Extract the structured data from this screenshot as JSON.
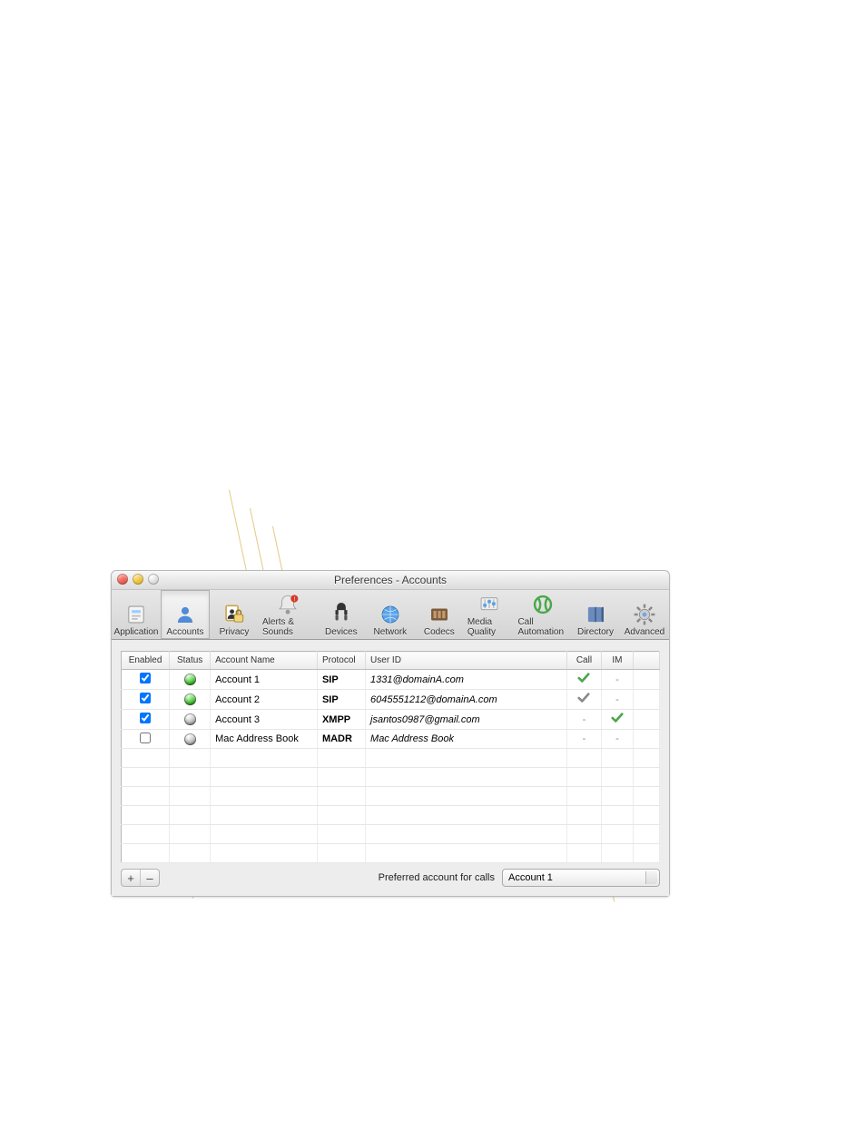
{
  "window_title": "Preferences - Accounts",
  "toolbar": [
    {
      "id": "application",
      "label": "Application",
      "selected": false
    },
    {
      "id": "accounts",
      "label": "Accounts",
      "selected": true
    },
    {
      "id": "privacy",
      "label": "Privacy",
      "selected": false
    },
    {
      "id": "alerts",
      "label": "Alerts & Sounds",
      "selected": false
    },
    {
      "id": "devices",
      "label": "Devices",
      "selected": false
    },
    {
      "id": "network",
      "label": "Network",
      "selected": false
    },
    {
      "id": "codecs",
      "label": "Codecs",
      "selected": false
    },
    {
      "id": "media",
      "label": "Media Quality",
      "selected": false
    },
    {
      "id": "callauto",
      "label": "Call Automation",
      "selected": false
    },
    {
      "id": "directory",
      "label": "Directory",
      "selected": false
    },
    {
      "id": "advanced",
      "label": "Advanced",
      "selected": false
    }
  ],
  "columns": {
    "enabled": "Enabled",
    "status": "Status",
    "account_name": "Account Name",
    "protocol": "Protocol",
    "user_id": "User ID",
    "call": "Call",
    "im": "IM"
  },
  "rows": [
    {
      "enabled": true,
      "status": "green",
      "name": "Account 1",
      "protocol": "SIP",
      "user_id": "1331@domainA.com",
      "call": "green-check",
      "im": "dash"
    },
    {
      "enabled": true,
      "status": "green",
      "name": "Account 2",
      "protocol": "SIP",
      "user_id": "6045551212@domainA.com",
      "call": "gray-check",
      "im": "dash"
    },
    {
      "enabled": true,
      "status": "gray",
      "name": "Account 3",
      "protocol": "XMPP",
      "user_id": "jsantos0987@gmail.com",
      "call": "dash",
      "im": "green-check"
    },
    {
      "enabled": false,
      "status": "gray",
      "name": "Mac Address Book",
      "protocol": "MADR",
      "user_id": "Mac Address Book",
      "call": "dash",
      "im": "dash"
    }
  ],
  "empty_rows": 6,
  "buttons": {
    "add": "+",
    "remove": "–"
  },
  "preferred_label": "Preferred account for calls",
  "preferred_value": "Account 1"
}
